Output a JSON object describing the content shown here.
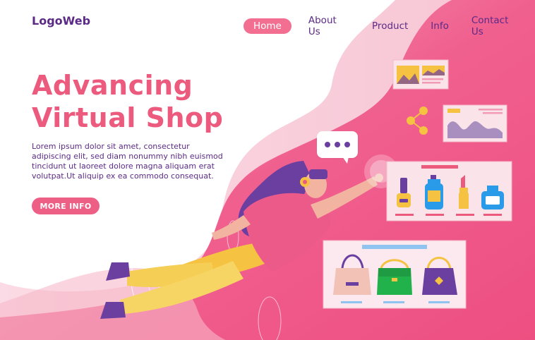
{
  "header": {
    "logo": "LogoWeb",
    "nav": [
      {
        "label": "Home",
        "active": true
      },
      {
        "label": "About Us",
        "active": false
      },
      {
        "label": "Product",
        "active": false
      },
      {
        "label": "Info",
        "active": false
      },
      {
        "label": "Contact Us",
        "active": false
      }
    ]
  },
  "hero": {
    "title_line1": "Advancing",
    "title_line2": "Virtual Shop",
    "description": "Lorem ipsum dolor sit amet, consectetur adipiscing elit, sed diam nonummy nibh euismod tincidunt ut laoreet dolore magna aliquam erat volutpat.Ut aliquip ex ea commodo consequat.",
    "cta_label": "MORE INFO"
  },
  "colors": {
    "brand_purple": "#5b2a86",
    "accent_pink": "#ec5a7e",
    "hero_wave": "#f0528a",
    "pale_pink": "#f9d3de"
  }
}
